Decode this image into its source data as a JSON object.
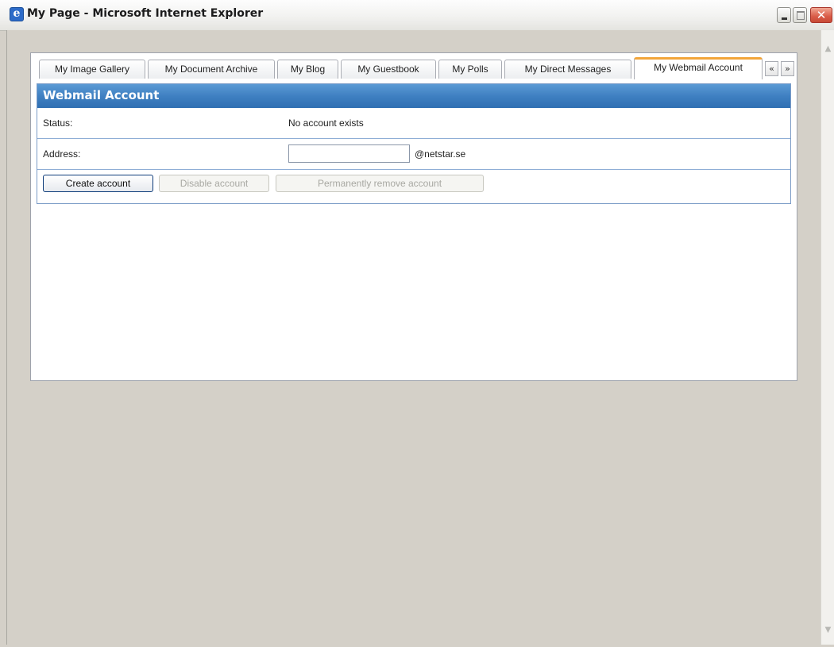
{
  "window": {
    "title": "My Page - Microsoft Internet Explorer",
    "app_icon_glyph": "e",
    "close_glyph": "✕"
  },
  "tabs": [
    {
      "label": "My Image Gallery",
      "active": false
    },
    {
      "label": "My Document Archive",
      "active": false
    },
    {
      "label": "My Blog",
      "active": false
    },
    {
      "label": "My Guestbook",
      "active": false
    },
    {
      "label": "My Polls",
      "active": false
    },
    {
      "label": "My Direct Messages",
      "active": false
    },
    {
      "label": "My Webmail Account",
      "active": true
    }
  ],
  "tab_nav": {
    "prev": "«",
    "next": "»"
  },
  "webmail": {
    "header": "Webmail Account",
    "status_label": "Status:",
    "status_value": "No account exists",
    "address_label": "Address:",
    "address_value": "",
    "address_domain": "@netstar.se",
    "buttons": {
      "create": "Create account",
      "disable": "Disable account",
      "remove": "Permanently remove account"
    }
  },
  "colors": {
    "header_blue": "#3f80c2",
    "active_tab_accent": "#f2a53a",
    "close_button": "#d95b47"
  }
}
